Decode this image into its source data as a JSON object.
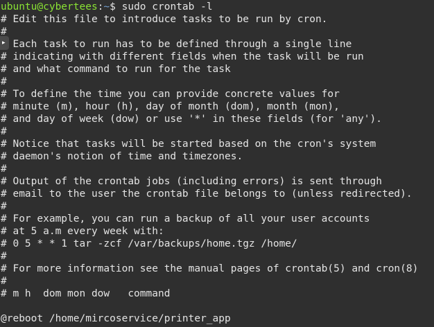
{
  "prompt": {
    "user_host": "ubuntu@cybertees",
    "separator": ":",
    "path": "~",
    "symbol": "$",
    "command": " sudo crontab -l"
  },
  "side_handle_glyph": "▸",
  "output_lines": [
    "# Edit this file to introduce tasks to be run by cron.",
    "#",
    "# Each task to run has to be defined through a single line",
    "# indicating with different fields when the task will be run",
    "# and what command to run for the task",
    "#",
    "# To define the time you can provide concrete values for",
    "# minute (m), hour (h), day of month (dom), month (mon),",
    "# and day of week (dow) or use '*' in these fields (for 'any').",
    "#",
    "# Notice that tasks will be started based on the cron's system",
    "# daemon's notion of time and timezones.",
    "#",
    "# Output of the crontab jobs (including errors) is sent through",
    "# email to the user the crontab file belongs to (unless redirected).",
    "#",
    "# For example, you can run a backup of all your user accounts",
    "# at 5 a.m every week with:",
    "# 0 5 * * 1 tar -zcf /var/backups/home.tgz /home/",
    "#",
    "# For more information see the manual pages of crontab(5) and cron(8)",
    "#",
    "# m h  dom mon dow   command",
    "",
    "@reboot /home/mircoservice/printer_app"
  ]
}
